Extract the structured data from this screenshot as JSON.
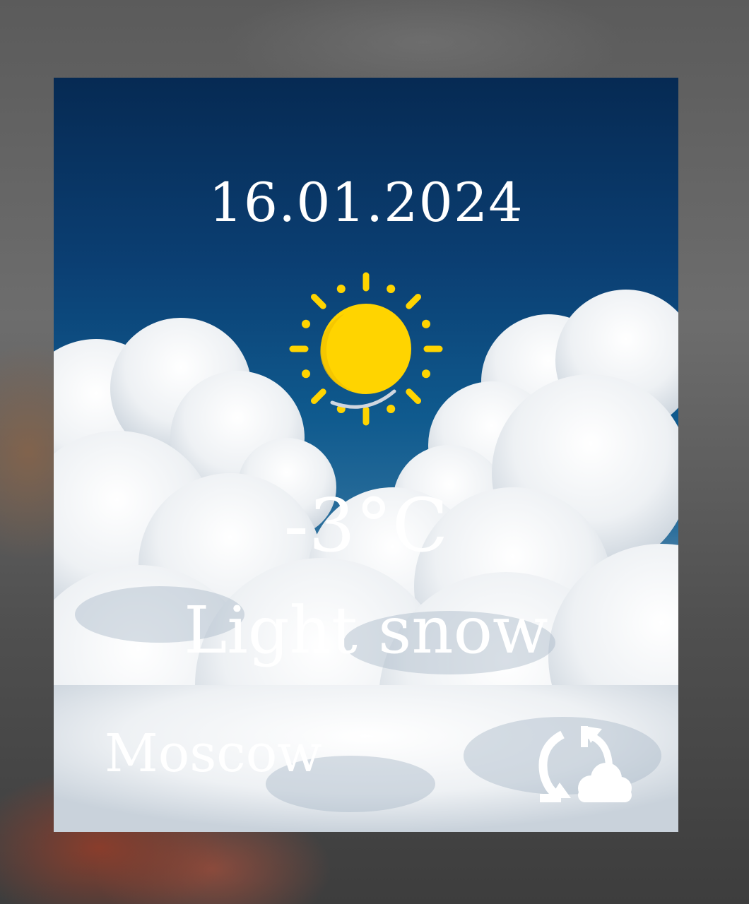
{
  "widget": {
    "date": "16.01.2024",
    "weather_icon": "sun-icon",
    "temperature": "-3°C",
    "condition": "Light snow",
    "city": "Moscow",
    "refresh_icon": "refresh-weather-icon",
    "colors": {
      "sun": "#FFD400",
      "sky_top": "#062A53",
      "sky_mid": "#0F5A8E",
      "text": "#FFFFFF"
    }
  }
}
